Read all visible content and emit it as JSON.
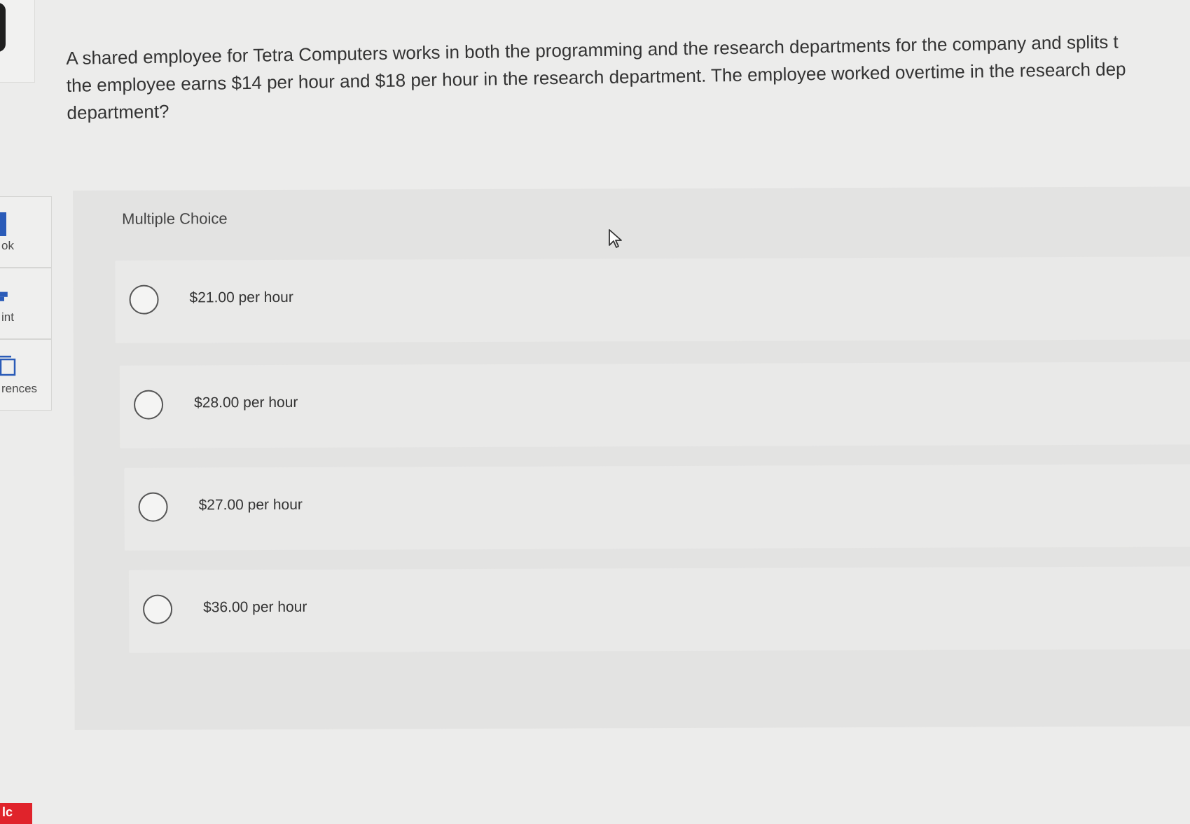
{
  "question": {
    "lines": [
      "A shared employee for Tetra Computers works in both the programming and the research departments for the company and splits t",
      "the employee earns $14 per hour and $18 per hour in the research department. The employee worked overtime in the research dep",
      "department?"
    ]
  },
  "sidebar": {
    "items": [
      {
        "label": "ok",
        "icon": "book-icon"
      },
      {
        "label": "int",
        "icon": "print-icon"
      },
      {
        "label": "rences",
        "icon": "references-icon"
      }
    ]
  },
  "multiple_choice": {
    "header": "Multiple Choice",
    "options": [
      {
        "label": "$21.00 per hour"
      },
      {
        "label": "$28.00 per hour"
      },
      {
        "label": "$27.00 per hour"
      },
      {
        "label": "$36.00 per hour"
      }
    ]
  },
  "logo": {
    "text": "lc",
    "color": "#e0232b"
  },
  "colors": {
    "background": "#ececeb",
    "panel": "#e3e3e2"
  }
}
